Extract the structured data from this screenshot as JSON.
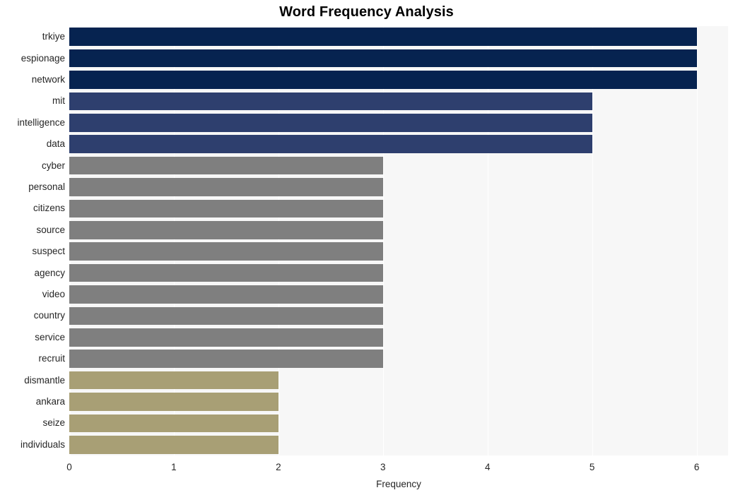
{
  "chart_data": {
    "type": "bar",
    "orientation": "horizontal",
    "title": "Word Frequency Analysis",
    "xlabel": "Frequency",
    "ylabel": "",
    "xlim": [
      0,
      6.3
    ],
    "xticks": [
      "0",
      "1",
      "2",
      "3",
      "4",
      "5",
      "6"
    ],
    "xtick_values": [
      0,
      1,
      2,
      3,
      4,
      5,
      6
    ],
    "grid": "vertical-white-on-light-gray",
    "legend": "none",
    "categories": [
      "trkiye",
      "espionage",
      "network",
      "mit",
      "intelligence",
      "data",
      "cyber",
      "personal",
      "citizens",
      "source",
      "suspect",
      "agency",
      "video",
      "country",
      "service",
      "recruit",
      "dismantle",
      "ankara",
      "seize",
      "individuals"
    ],
    "values": [
      6,
      6,
      6,
      5,
      5,
      5,
      3,
      3,
      3,
      3,
      3,
      3,
      3,
      3,
      3,
      3,
      2,
      2,
      2,
      2
    ],
    "bar_colors": [
      "#062350",
      "#062350",
      "#062350",
      "#2e3f6e",
      "#2e3f6e",
      "#2e3f6e",
      "#7f7f7f",
      "#7f7f7f",
      "#7f7f7f",
      "#7f7f7f",
      "#7f7f7f",
      "#7f7f7f",
      "#7f7f7f",
      "#7f7f7f",
      "#7f7f7f",
      "#7f7f7f",
      "#a89f75",
      "#a89f75",
      "#a89f75",
      "#a89f75"
    ]
  },
  "colors": {
    "plot_background": "#f7f7f7",
    "figure_background": "#ffffff",
    "gridline": "#ffffff",
    "text": "#262626",
    "title": "#000000",
    "navy_dark": "#062350",
    "navy_medium": "#2e3f6e",
    "gray": "#7f7f7f",
    "khaki": "#a89f75"
  }
}
